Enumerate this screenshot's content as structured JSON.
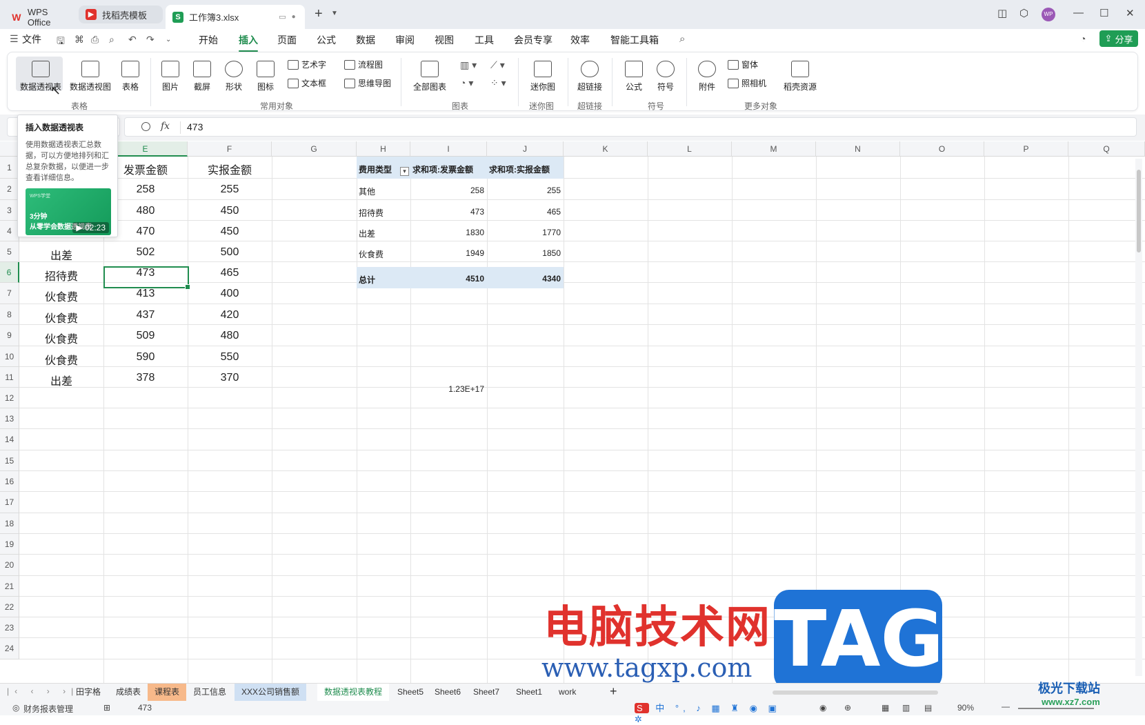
{
  "titlebar": {
    "tabs": [
      {
        "label": "WPS Office",
        "logo": "W"
      },
      {
        "label": "找稻壳模板",
        "logo": "▶"
      },
      {
        "label": "工作簿3.xlsx",
        "logo": "S"
      }
    ],
    "add_tab": "+",
    "avatar": "WP"
  },
  "menubar": {
    "file": "文件",
    "items": [
      "开始",
      "插入",
      "页面",
      "公式",
      "数据",
      "审阅",
      "视图",
      "工具",
      "会员专享",
      "效率",
      "智能工具箱"
    ],
    "active": "插入",
    "share": "分享"
  },
  "ribbon": {
    "groups": {
      "table": {
        "label": "表格",
        "buttons": [
          "数据透视表",
          "数据透视图",
          "表格"
        ]
      },
      "common": {
        "label": "常用对象",
        "buttons": [
          "图片",
          "截屏",
          "形状",
          "图标"
        ],
        "small": [
          "艺术字",
          "流程图",
          "文本框",
          "思维导图"
        ]
      },
      "chart": {
        "label": "图表",
        "buttons": [
          "全部图表"
        ]
      },
      "sparkline": {
        "label": "迷你图",
        "buttons": [
          "迷你图"
        ]
      },
      "hyperlink": {
        "label": "超链接",
        "buttons": [
          "超链接"
        ]
      },
      "symbol": {
        "label": "符号",
        "buttons": [
          "公式",
          "符号"
        ]
      },
      "more": {
        "label": "更多对象",
        "buttons": [
          "附件"
        ],
        "small": [
          "窗体",
          "照相机"
        ],
        "extra": "稻壳资源"
      }
    }
  },
  "tooltip": {
    "title": "插入数据透视表",
    "desc": "使用数据透视表汇总数据，可以方便地排列和汇总复杂数据，以便进一步查看详细信息。",
    "video_tag": "WPS学堂",
    "video_line1": "3分钟",
    "video_line2": "从零学会数据透视表",
    "duration": "02:23"
  },
  "formula": {
    "fx": "fx",
    "value": "473"
  },
  "sheet": {
    "columns": [
      "E",
      "F",
      "G",
      "H",
      "I",
      "J",
      "K",
      "L",
      "M",
      "N",
      "O",
      "P",
      "Q"
    ],
    "rows": [
      "1",
      "2",
      "3",
      "4",
      "5",
      "6",
      "7",
      "8",
      "9",
      "10",
      "11",
      "12",
      "13",
      "14",
      "15",
      "16",
      "17",
      "18",
      "19",
      "20",
      "21",
      "22",
      "23",
      "24"
    ],
    "headers": {
      "e": "发票金额",
      "f": "实报金额"
    },
    "data": [
      {
        "d": "",
        "e": "258",
        "f": "255"
      },
      {
        "d": "",
        "e": "480",
        "f": "450"
      },
      {
        "d": "",
        "e": "470",
        "f": "450"
      },
      {
        "d": "出差",
        "e": "502",
        "f": "500"
      },
      {
        "d": "招待费",
        "e": "473",
        "f": "465"
      },
      {
        "d": "伙食费",
        "e": "413",
        "f": "400"
      },
      {
        "d": "伙食费",
        "e": "437",
        "f": "420"
      },
      {
        "d": "伙食费",
        "e": "509",
        "f": "480"
      },
      {
        "d": "伙食费",
        "e": "590",
        "f": "550"
      },
      {
        "d": "出差",
        "e": "378",
        "f": "370"
      }
    ],
    "pivot": {
      "headers": [
        "费用类型",
        "求和项:发票金额",
        "求和项:实报金额"
      ],
      "rows": [
        {
          "type": "其他",
          "invoice": "258",
          "actual": "255"
        },
        {
          "type": "招待费",
          "invoice": "473",
          "actual": "465"
        },
        {
          "type": "出差",
          "invoice": "1830",
          "actual": "1770"
        },
        {
          "type": "伙食费",
          "invoice": "1949",
          "actual": "1850"
        }
      ],
      "total": {
        "type": "总计",
        "invoice": "4510",
        "actual": "4340"
      }
    },
    "i11": "1.23E+17"
  },
  "sheets": {
    "tabs": [
      "田字格",
      "成绩表",
      "课程表",
      "员工信息",
      "XXX公司销售额",
      "数据透视表教程",
      "Sheet5",
      "Sheet6",
      "Sheet7",
      "Sheet1",
      "work"
    ],
    "active": "数据透视表教程"
  },
  "status": {
    "module": "财务报表管理",
    "value": "473",
    "zoom": "90%"
  },
  "watermark": {
    "title": "电脑技术网",
    "tag": "TAG",
    "url": "www.tagxp.com",
    "site": "极光下载站",
    "site_url": "www.xz7.com"
  }
}
